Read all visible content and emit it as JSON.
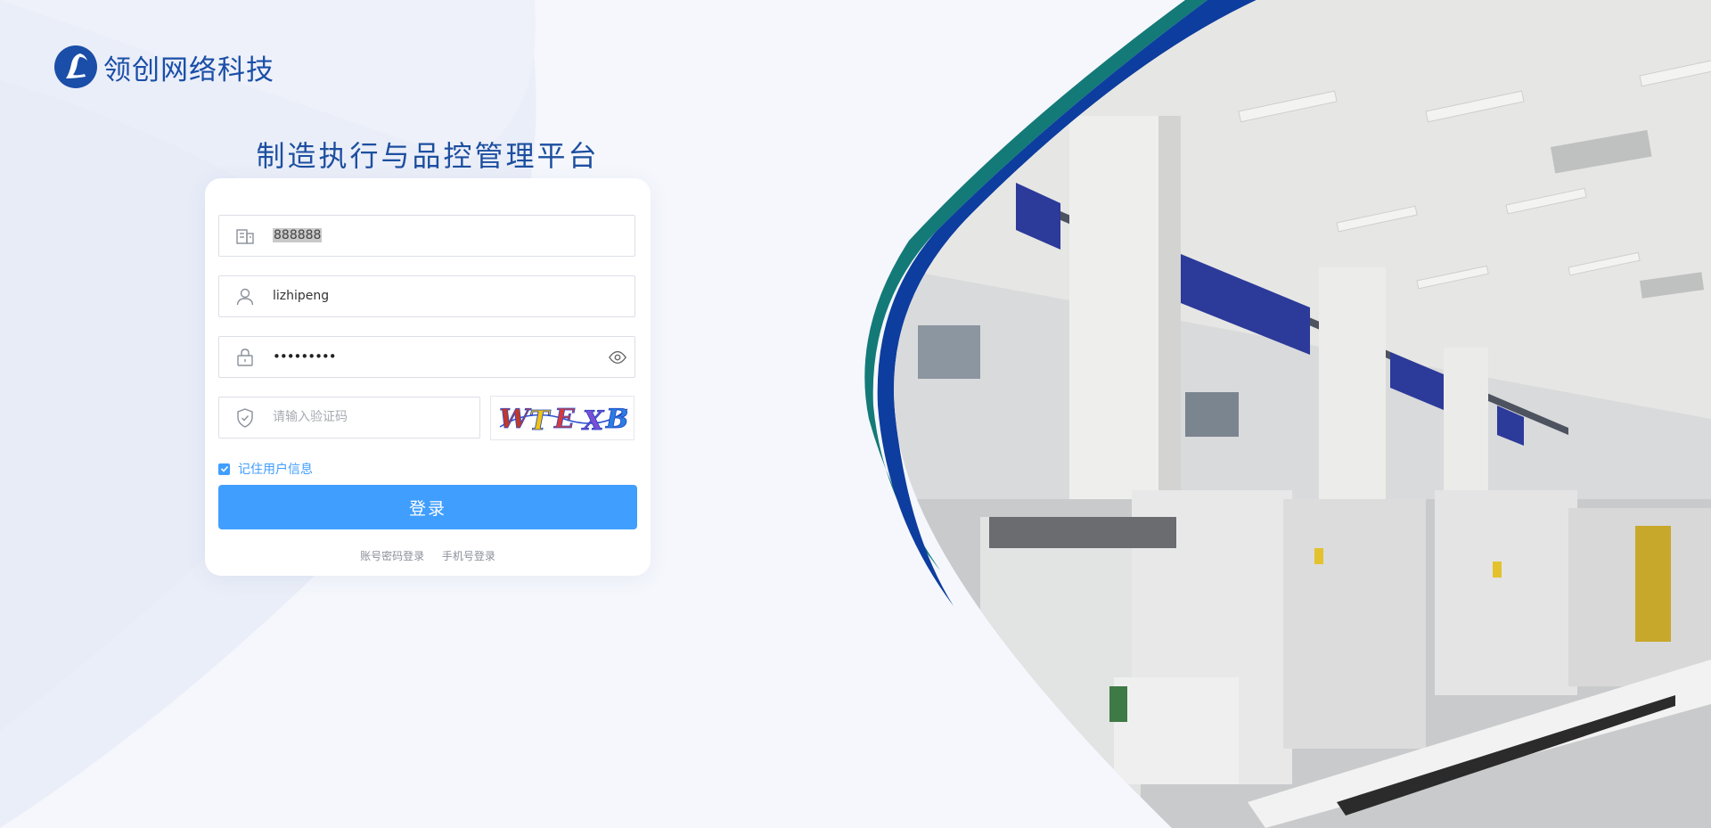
{
  "brand": {
    "name": "领创网络科技"
  },
  "platform": {
    "title": "制造执行与品控管理平台"
  },
  "form": {
    "tenant": {
      "value": "888888",
      "icon": "building-icon"
    },
    "username": {
      "value": "lizhipeng",
      "icon": "user-icon"
    },
    "password": {
      "masked": "•••••••••",
      "icon": "lock-icon",
      "toggle_icon": "eye-icon"
    },
    "captcha": {
      "placeholder": "请输入验证码",
      "icon": "shield-icon",
      "image_text": "WTEXB"
    },
    "remember": {
      "label": "记住用户信息",
      "checked": true
    },
    "submit_label": "登录",
    "alt_logins": {
      "account": "账号密码登录",
      "phone": "手机号登录"
    }
  },
  "colors": {
    "accent": "#409eff",
    "brand": "#1a4ea8",
    "swoosh_blue": "#0d3d9e",
    "swoosh_teal": "#137a78"
  }
}
